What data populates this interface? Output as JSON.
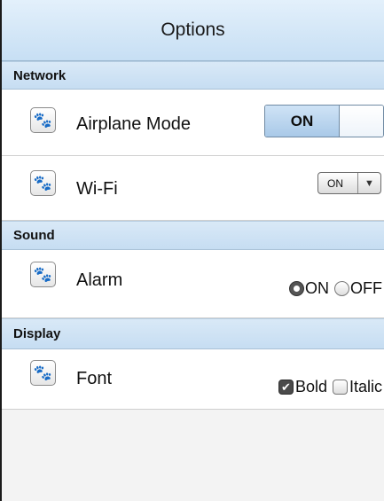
{
  "header": {
    "title": "Options"
  },
  "sections": {
    "network": {
      "title": "Network",
      "airplane": {
        "label": "Airplane Mode",
        "icon": "paw-icon-blue",
        "icon_color": "#2a8fe0",
        "toggle_on_label": "ON",
        "state": "ON"
      },
      "wifi": {
        "label": "Wi-Fi",
        "icon": "paw-icon-purple",
        "icon_color": "#7b4fc2",
        "selected": "ON"
      }
    },
    "sound": {
      "title": "Sound",
      "alarm": {
        "label": "Alarm",
        "icon": "paw-icon-orange",
        "icon_color": "#f0a020",
        "option_on": "ON",
        "option_off": "OFF",
        "selected": "ON"
      }
    },
    "display": {
      "title": "Display",
      "font": {
        "label": "Font",
        "icon": "paw-icon-red",
        "icon_color": "#e0302a",
        "option_bold": "Bold",
        "option_italic": "Italic",
        "bold_checked": true,
        "italic_checked": false
      }
    }
  }
}
